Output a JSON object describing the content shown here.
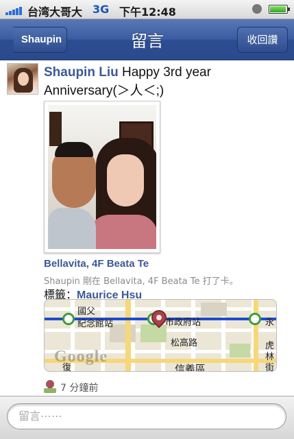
{
  "status_bar": {
    "carrier": "台湾大哥大",
    "network": "3G",
    "time": "下午12:48",
    "battery_level": 0.9
  },
  "nav": {
    "back_label": "Shaupin",
    "title": "留言",
    "right_label": "收回讚"
  },
  "post": {
    "author": "Shaupin Liu",
    "message": "Happy 3rd year Anniversary(＞人＜;)",
    "place": "Bellavita, 4F Beata Te",
    "checkin_text": "Shaupin 剛在 Bellavita, 4F Beata Te 打了卡。",
    "tag_prefix": "標籤：",
    "tag_name": "Maurice Hsu",
    "time_ago": "7 分鐘前"
  },
  "map": {
    "labels": [
      "國父",
      "紀念館站",
      "市政府站",
      "松高路",
      "信義區",
      "永",
      "虎",
      "林",
      "街",
      "復"
    ],
    "watermark": "Google"
  },
  "comment": {
    "placeholder": "留言⋯⋯"
  },
  "colors": {
    "nav_blue": "#3b5998",
    "link_blue": "#3b5998",
    "metro_line": "#1f4bd0",
    "station_green": "#3f9c3a",
    "pin_red": "#a7434b"
  },
  "icons": [
    "signal-bars-icon",
    "alarm-icon",
    "battery-icon",
    "back-chevron-icon",
    "location-pin-icon"
  ]
}
